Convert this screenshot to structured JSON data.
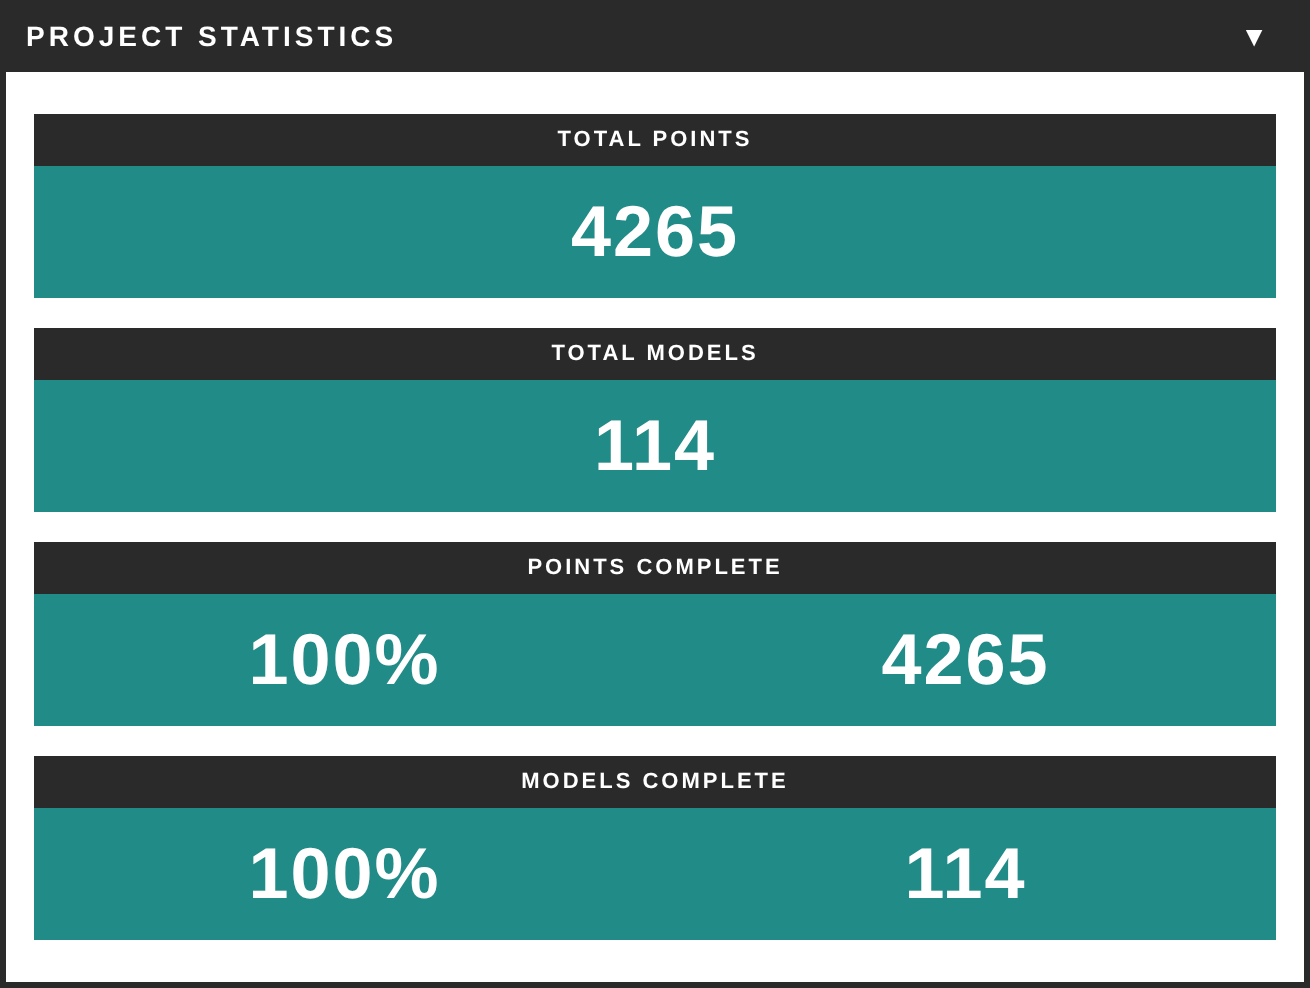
{
  "panel": {
    "title": "PROJECT STATISTICS",
    "toggle": "▼"
  },
  "stats": [
    {
      "label": "TOTAL POINTS",
      "values": [
        "4265"
      ]
    },
    {
      "label": "TOTAL MODELS",
      "values": [
        "114"
      ]
    },
    {
      "label": "POINTS COMPLETE",
      "values": [
        "100%",
        "4265"
      ]
    },
    {
      "label": "MODELS COMPLETE",
      "values": [
        "100%",
        "114"
      ]
    }
  ]
}
